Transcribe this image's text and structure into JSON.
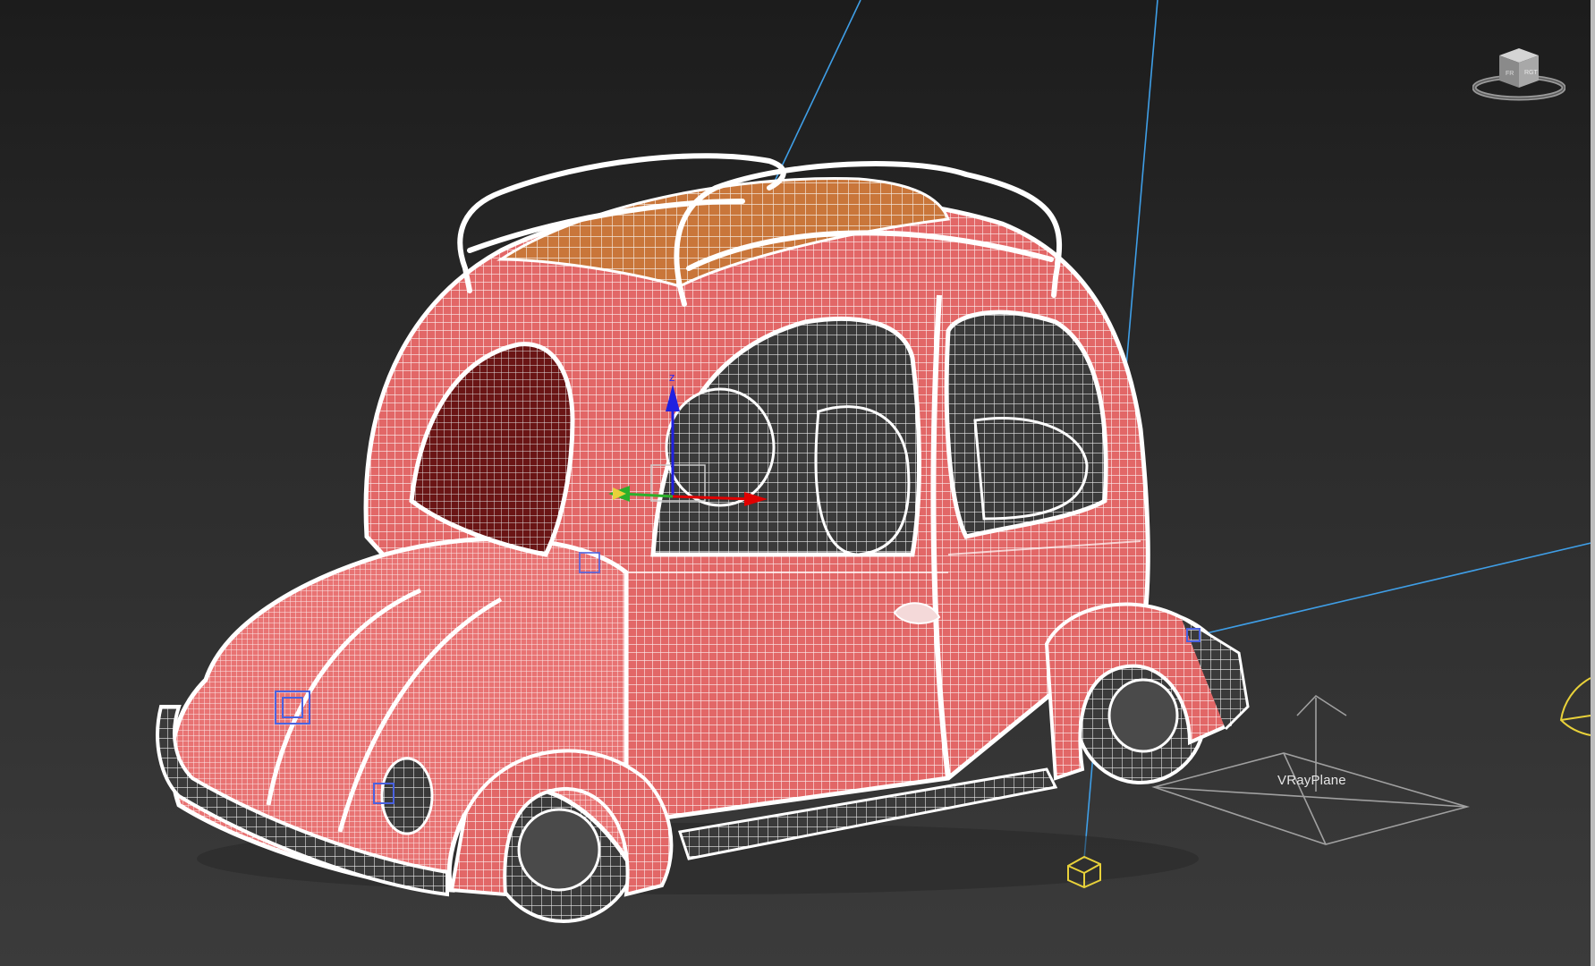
{
  "viewport": {
    "name": "perspective-viewport",
    "shading_mode": "wireframe"
  },
  "scene": {
    "model": "beetle-car",
    "objects": [
      {
        "type": "mesh",
        "name": "car-body",
        "wire_color": "#ffffff",
        "face_color": "#e46a6a"
      },
      {
        "type": "mesh",
        "name": "roof-rack-basket",
        "face_color": "#d07a3a"
      },
      {
        "type": "helper",
        "name": "VRayPlane",
        "label": "VRayPlane"
      },
      {
        "type": "camera",
        "name": "camera-target-yellow",
        "color": "#e8d13a"
      },
      {
        "type": "light",
        "name": "light-lines",
        "color": "#4ea6e8"
      }
    ]
  },
  "labels": {
    "vray_plane": "VRayPlane"
  },
  "gizmo": {
    "x_color": "#e00000",
    "y_color": "#2bb02b",
    "z_color": "#2020e0"
  },
  "viewcube": {
    "icon": "viewcube-icon"
  }
}
